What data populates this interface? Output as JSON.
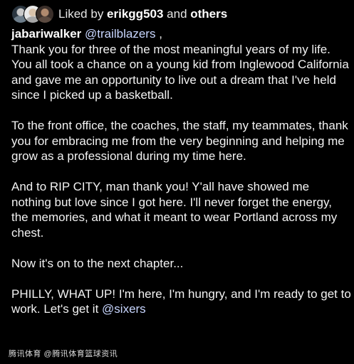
{
  "likes": {
    "prefix": "Liked by ",
    "user": "erikgg503",
    "middle": " and ",
    "others": "others"
  },
  "post": {
    "author": "jabariwalker",
    "mention": "@trailblazers",
    "mention_suffix": " ,",
    "paragraphs": [
      "Thank you for three of the most meaningful years of my life. You all took a chance on a young kid from Inglewood California and gave me an opportunity to live out a dream that I've held since I picked up a basketball.",
      "To the front office, the coaches, the staff, my teammates, thank you for embracing me from the very beginning and helping me grow as a professional during my time here.",
      "And to RIP CITY, man thank you! Y'all have showed me nothing but love since I got here. I'll never forget the energy, the memories, and what it meant to wear Portland across my chest.",
      "Now it's on to the next chapter..."
    ],
    "last_paragraph_text": "PHILLY, WHAT UP! I'm here, I'm hungry, and I'm ready to get to work. Let's get it ",
    "last_mention": "@sixers"
  },
  "watermark": "腾讯体育 @腾讯体育篮球资讯",
  "colors": {
    "background": "#000000",
    "text": "#f2f2f2",
    "mention": "#c8d6ff"
  }
}
